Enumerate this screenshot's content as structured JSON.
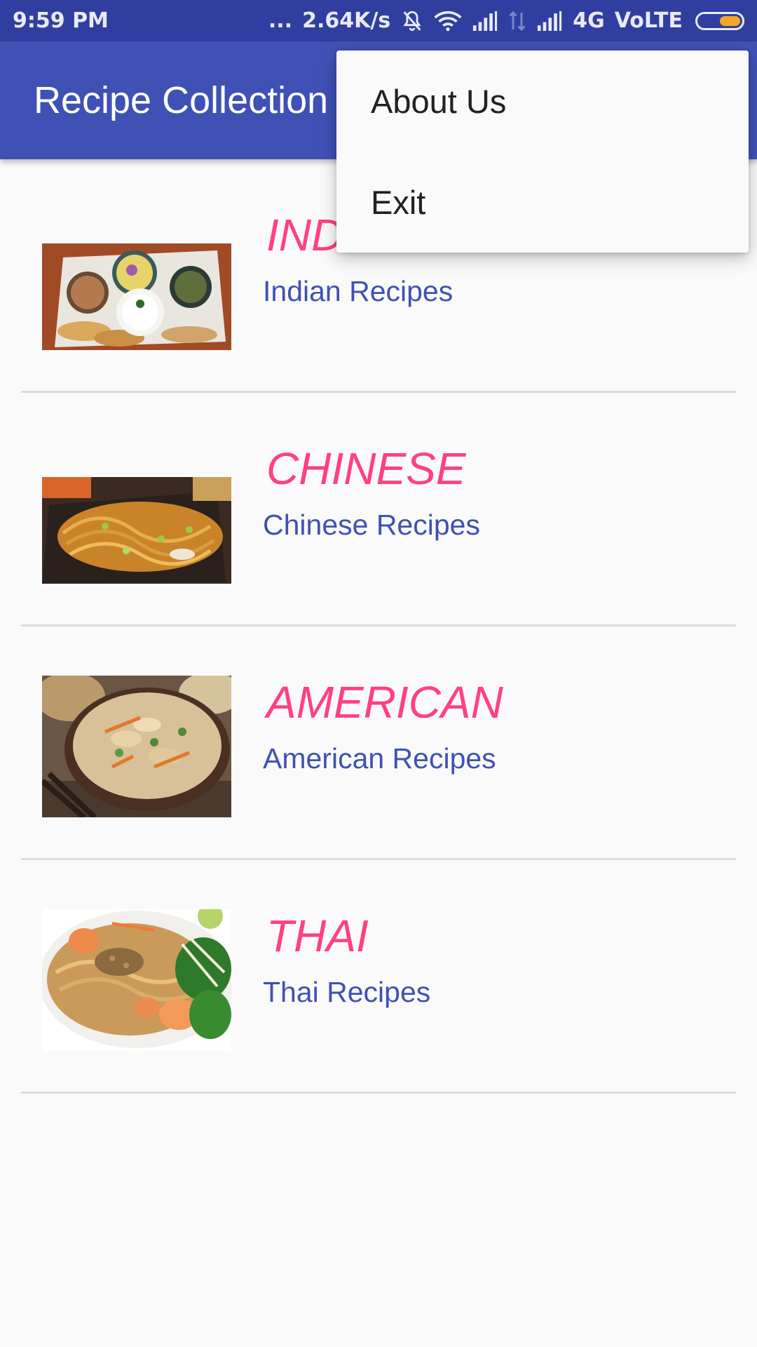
{
  "status_bar": {
    "time": "9:59 PM",
    "dots": "...",
    "speed": "2.64K/s",
    "network": "4G",
    "volte": "VoLTE",
    "icons": [
      "mute-bell-icon",
      "wifi-icon",
      "signal-icon",
      "data-arrows-icon",
      "signal-icon",
      "battery-icon"
    ],
    "battery_level": 0.45
  },
  "app_bar": {
    "title": "Recipe Collection"
  },
  "menu": {
    "items": [
      {
        "label": "About Us"
      },
      {
        "label": "Exit"
      }
    ]
  },
  "recipes": [
    {
      "title": "INDIAN",
      "subtitle": "Indian Recipes",
      "image": "indian-thali-image"
    },
    {
      "title": "CHINESE",
      "subtitle": "Chinese Recipes",
      "image": "chinese-noodles-image"
    },
    {
      "title": "AMERICAN",
      "subtitle": "American Recipes",
      "image": "american-stirfry-image"
    },
    {
      "title": "THAI",
      "subtitle": "Thai Recipes",
      "image": "thai-padthai-image"
    }
  ],
  "colors": {
    "status_bar": "#303f9f",
    "primary": "#3f51b5",
    "accent": "#ff4081",
    "background": "#fafafa",
    "divider": "#dcdcdc"
  }
}
